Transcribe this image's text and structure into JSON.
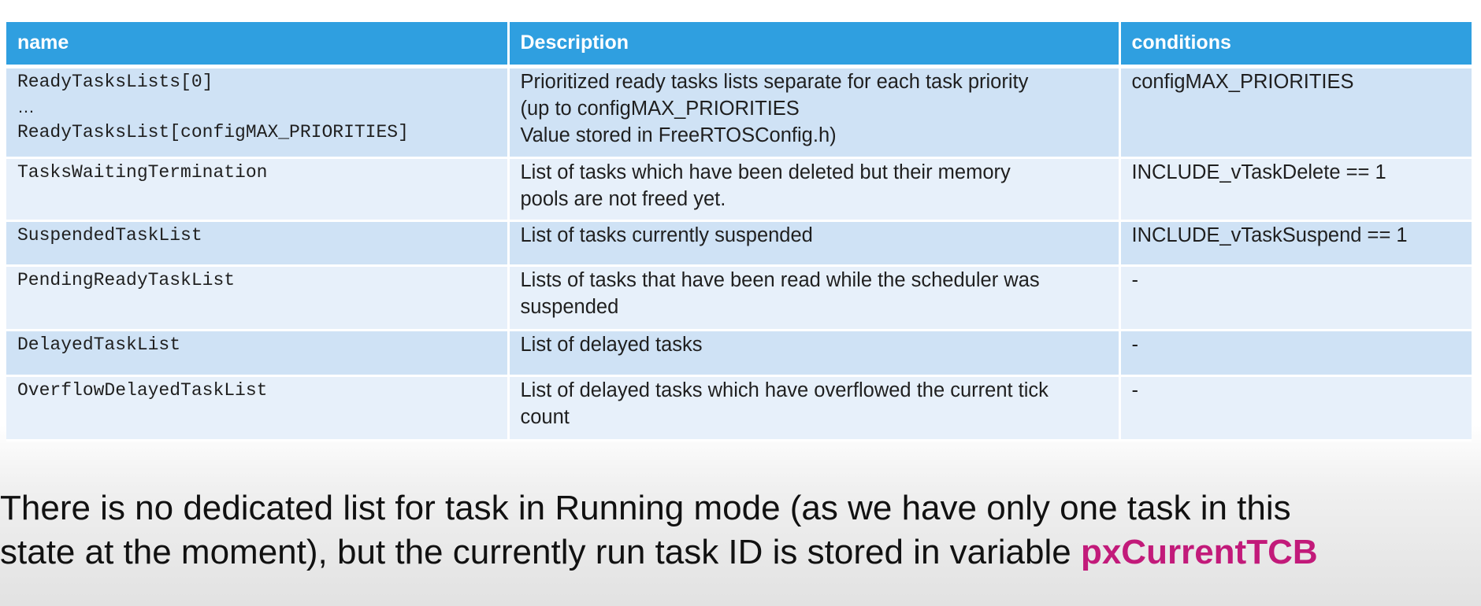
{
  "table": {
    "headers": {
      "name": "name",
      "description": "Description",
      "conditions": "conditions"
    },
    "rows": [
      {
        "name_lines": [
          "ReadyTasksLists[0]",
          "…",
          "ReadyTasksList[configMAX_PRIORITIES]"
        ],
        "description_lines": [
          "Prioritized ready tasks lists separate for each task priority",
          "(up to configMAX_PRIORITIES",
          "Value stored in FreeRTOSConfig.h)"
        ],
        "condition": "configMAX_PRIORITIES"
      },
      {
        "name_lines": [
          "TasksWaitingTermination"
        ],
        "description_lines": [
          "List of tasks which have been deleted but their memory",
          "pools are not freed yet."
        ],
        "condition": "INCLUDE_vTaskDelete == 1"
      },
      {
        "name_lines": [
          "SuspendedTaskList"
        ],
        "description_lines": [
          "List of tasks currently suspended"
        ],
        "condition": "INCLUDE_vTaskSuspend == 1"
      },
      {
        "name_lines": [
          "PendingReadyTaskList"
        ],
        "description_lines": [
          "Lists of tasks that have been read while the scheduler was",
          "suspended"
        ],
        "condition": "-"
      },
      {
        "name_lines": [
          "DelayedTaskList"
        ],
        "description_lines": [
          "List of delayed tasks"
        ],
        "condition": "-"
      },
      {
        "name_lines": [
          "OverflowDelayedTaskList"
        ],
        "description_lines": [
          "List of delayed tasks which have overflowed the current tick",
          "count"
        ],
        "condition": "-"
      }
    ]
  },
  "footnote": {
    "line1": "There is no dedicated list for task in Running mode (as we have only one task in this",
    "line2_prefix": "state at the moment), but the currently run task ID is stored in variable ",
    "highlight": "pxCurrentTCB"
  },
  "colors": {
    "header_bg": "#2f9fe0",
    "row_odd_bg": "#cfe2f5",
    "row_even_bg": "#e7f0fa",
    "highlight_text": "#c21a7a"
  }
}
